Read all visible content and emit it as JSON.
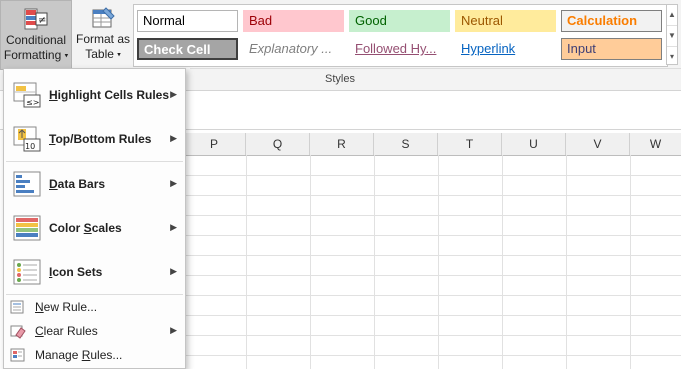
{
  "ribbon": {
    "conditional_formatting": {
      "line1": "Conditional",
      "line2": "Formatting"
    },
    "format_as_table": {
      "line1": "Format as",
      "line2": "Table"
    },
    "styles_label": "Styles"
  },
  "cell_styles": [
    {
      "label": "Normal",
      "fg": "#000000",
      "bg": "#ffffff",
      "border": "#b5b5b5"
    },
    {
      "label": "Bad",
      "fg": "#9c0006",
      "bg": "#ffc7ce",
      "border": "#ffc7ce"
    },
    {
      "label": "Good",
      "fg": "#006100",
      "bg": "#c6efce",
      "border": "#c6efce"
    },
    {
      "label": "Neutral",
      "fg": "#9c5700",
      "bg": "#ffeb9c",
      "border": "#ffeb9c"
    },
    {
      "label": "Calculation",
      "fg": "#fa7d00",
      "bg": "#f2f2f2",
      "border": "#7f7f7f"
    },
    {
      "label": "Check Cell",
      "fg": "#ffffff",
      "bg": "#a5a5a5",
      "border": "#3f3f3f"
    },
    {
      "label": "Explanatory ...",
      "fg": "#7f7f7f",
      "bg": "#ffffff",
      "border": "#ffffff"
    },
    {
      "label": "Followed Hy...",
      "fg": "#954f72",
      "bg": "#ffffff",
      "border": "#ffffff"
    },
    {
      "label": "Hyperlink",
      "fg": "#0563c1",
      "bg": "#ffffff",
      "border": "#ffffff"
    },
    {
      "label": "Input",
      "fg": "#3f3f76",
      "bg": "#ffcc99",
      "border": "#7f7f7f"
    }
  ],
  "columns": [
    "P",
    "Q",
    "R",
    "S",
    "T",
    "U",
    "V",
    "W"
  ],
  "menu": {
    "highlight": {
      "before": "",
      "mnemonic": "H",
      "after": "ighlight Cells Rules"
    },
    "topbottom": {
      "before": "",
      "mnemonic": "T",
      "after": "op/Bottom Rules"
    },
    "databars": {
      "before": "",
      "mnemonic": "D",
      "after": "ata Bars"
    },
    "colorscales": {
      "before": "Color ",
      "mnemonic": "S",
      "after": "cales"
    },
    "iconsets": {
      "before": "",
      "mnemonic": "I",
      "after": "con Sets"
    },
    "newrule": {
      "before": "",
      "mnemonic": "N",
      "after": "ew Rule..."
    },
    "clearrules": {
      "before": "",
      "mnemonic": "C",
      "after": "lear Rules"
    },
    "managerules": {
      "before": "Manage ",
      "mnemonic": "R",
      "after": "ules..."
    }
  },
  "icons": {
    "submenu_arrow": "▶",
    "dropdown_caret": "▾",
    "gallery_up": "▲",
    "gallery_down": "▼",
    "gallery_more": "▾"
  }
}
